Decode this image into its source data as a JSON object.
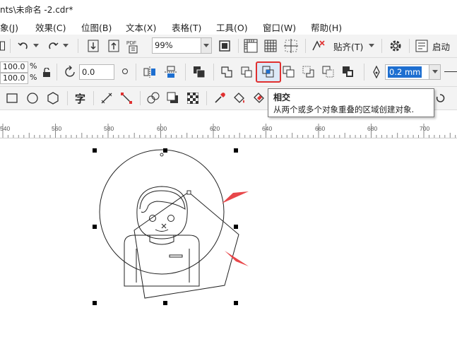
{
  "window": {
    "title": "nts\\未命名 -2.cdr*"
  },
  "menu": [
    "象(J)",
    "效果(C)",
    "位图(B)",
    "文本(X)",
    "表格(T)",
    "工具(O)",
    "窗口(W)",
    "帮助(H)"
  ],
  "standard_toolbar": {
    "zoom_value": "99%",
    "snap_label": "贴齐(T)",
    "launch_label": "启动",
    "pdf_label": "PDF"
  },
  "property_bar": {
    "scale_x": "100.0",
    "scale_y": "100.0",
    "percent_x": "%",
    "percent_y": "%",
    "rotation": "0.0",
    "outline_width": "0.2 mm"
  },
  "toolbox": {
    "text_tool_label": "字"
  },
  "tooltip": {
    "title": "相交",
    "description": "从两个或多个对象重叠的区域创建对象."
  },
  "ruler": {
    "ticks": [
      "540",
      "560",
      "580",
      "600",
      "620",
      "640",
      "660",
      "680",
      "700"
    ]
  },
  "colors": {
    "highlight_border": "#e03030",
    "arrow": "#e8474a",
    "selection_field": "#1e6fd0"
  }
}
